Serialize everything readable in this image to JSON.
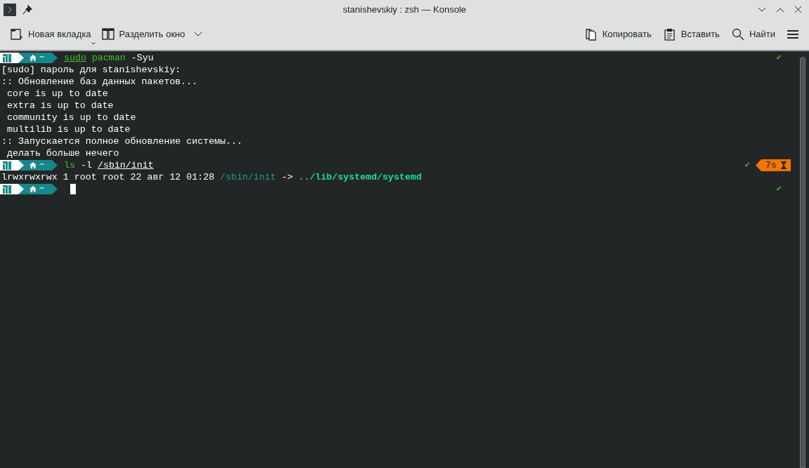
{
  "window": {
    "title": "stanishevskiy : zsh — Konsole"
  },
  "toolbar": {
    "left": [
      {
        "kind": "new-tab",
        "label": "Новая вкладка",
        "delayed_menu": true
      },
      {
        "kind": "split",
        "label": "Разделить окно",
        "menu": true
      }
    ],
    "right": [
      {
        "kind": "copy",
        "label": "Копировать"
      },
      {
        "kind": "paste",
        "label": "Вставить"
      },
      {
        "kind": "find",
        "label": "Найти"
      }
    ]
  },
  "terminal": {
    "lines": [
      {
        "kind": "prompt",
        "dir": "~",
        "command": [
          {
            "kind": "command",
            "text": "sudo",
            "underline": true
          },
          {
            "kind": "command",
            "text": "pacman",
            "underline": false
          },
          {
            "kind": "argument",
            "text": "-Syu",
            "underline": false
          }
        ],
        "status": "✔"
      },
      {
        "kind": "output",
        "segments": [
          {
            "text": "[sudo] пароль для stanishevskiy:",
            "color": "#fcfcfc"
          }
        ]
      },
      {
        "kind": "output",
        "segments": [
          {
            "text": ":: Обновление баз данных пакетов...",
            "color": "#fcfcfc"
          }
        ]
      },
      {
        "kind": "output",
        "segments": [
          {
            "text": " core is up to date",
            "color": "#fcfcfc"
          }
        ]
      },
      {
        "kind": "output",
        "segments": [
          {
            "text": " extra is up to date",
            "color": "#fcfcfc"
          }
        ]
      },
      {
        "kind": "output",
        "segments": [
          {
            "text": " community is up to date",
            "color": "#fcfcfc"
          }
        ]
      },
      {
        "kind": "output",
        "segments": [
          {
            "text": " multilib is up to date",
            "color": "#fcfcfc"
          }
        ]
      },
      {
        "kind": "output",
        "segments": [
          {
            "text": ":: Запускается полное обновление системы...",
            "color": "#fcfcfc"
          }
        ]
      },
      {
        "kind": "output",
        "segments": [
          {
            "text": " делать больше нечего",
            "color": "#fcfcfc"
          }
        ]
      },
      {
        "kind": "prompt",
        "dir": "~",
        "command": [
          {
            "kind": "command",
            "text": "ls",
            "underline": false
          },
          {
            "kind": "argument",
            "text": "-l",
            "underline": false
          },
          {
            "kind": "argument",
            "text": "/sbin/init",
            "underline": true
          }
        ],
        "status": "✔",
        "duration": "7s"
      },
      {
        "kind": "output",
        "segments": [
          {
            "text": "lrwxrwxrwx 1 root root 22 авг 12 01:28 ",
            "color": "#fcfcfc"
          },
          {
            "text": "/sbin/init",
            "color": "#16a085"
          },
          {
            "text": " -> "
          },
          {
            "text": "../lib/systemd/systemd",
            "color": "#1cdc9a",
            "bold": true
          }
        ]
      },
      {
        "kind": "prompt",
        "dir": "~",
        "status": "✔",
        "cursor": true
      }
    ]
  }
}
